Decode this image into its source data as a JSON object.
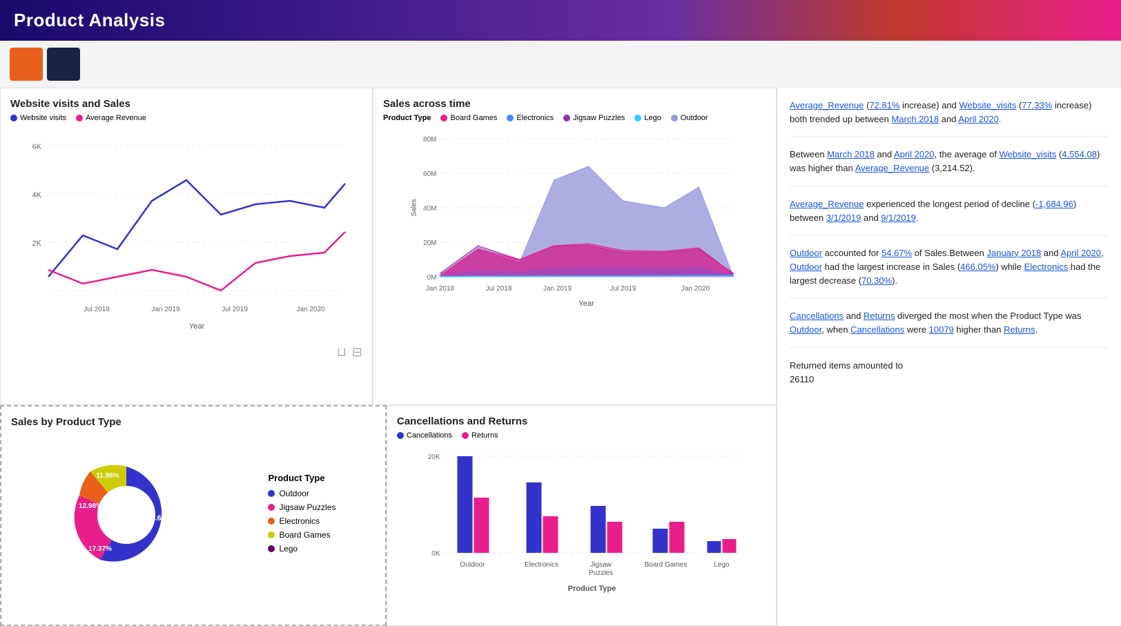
{
  "header": {
    "title": "Product Analysis"
  },
  "insights": [
    {
      "id": 1,
      "text_parts": [
        {
          "text": "Average_Revenue",
          "link": true
        },
        {
          "text": " ("
        },
        {
          "text": "72.81%",
          "link": true
        },
        {
          "text": " increase) and "
        },
        {
          "text": "Website_visits",
          "link": true
        },
        {
          "text": " ("
        },
        {
          "text": "77.33%",
          "link": true
        },
        {
          "text": " increase) both trended up between "
        },
        {
          "text": "March 2018",
          "link": true
        },
        {
          "text": " and "
        },
        {
          "text": "April 2020",
          "link": true
        },
        {
          "text": "."
        }
      ]
    },
    {
      "id": 2,
      "text_parts": [
        {
          "text": "Between "
        },
        {
          "text": "March 2018",
          "link": true
        },
        {
          "text": " and "
        },
        {
          "text": "April 2020",
          "link": true
        },
        {
          "text": ", the average of "
        },
        {
          "text": "Website_visits",
          "link": true
        },
        {
          "text": " ("
        },
        {
          "text": "4,554.08",
          "link": true
        },
        {
          "text": ") was higher than "
        },
        {
          "text": "Average_Revenue",
          "link": true
        },
        {
          "text": " (3,214.52)."
        }
      ]
    },
    {
      "id": 3,
      "text_parts": [
        {
          "text": "Average_Revenue",
          "link": true
        },
        {
          "text": " experienced the longest period of decline ("
        },
        {
          "text": "-1,684.96",
          "link": true
        },
        {
          "text": ") between "
        },
        {
          "text": "3/1/2019",
          "link": true
        },
        {
          "text": " and "
        },
        {
          "text": "9/1/2019",
          "link": true
        },
        {
          "text": "."
        }
      ]
    },
    {
      "id": 4,
      "text_parts": [
        {
          "text": "Outdoor",
          "link": true
        },
        {
          "text": " accounted for "
        },
        {
          "text": "54.67%",
          "link": true
        },
        {
          "text": " of Sales.Between "
        },
        {
          "text": "January 2018",
          "link": true
        },
        {
          "text": " and "
        },
        {
          "text": "April 2020",
          "link": true
        },
        {
          "text": ", "
        },
        {
          "text": "Outdoor",
          "link": true
        },
        {
          "text": " had the largest increase in Sales ("
        },
        {
          "text": "466.05%",
          "link": true
        },
        {
          "text": ") while "
        },
        {
          "text": "Electronics",
          "link": true
        },
        {
          "text": " had the largest decrease ("
        },
        {
          "text": "70.30%",
          "link": true
        },
        {
          "text": ")."
        }
      ]
    },
    {
      "id": 5,
      "text_parts": [
        {
          "text": "Cancellations",
          "link": true
        },
        {
          "text": " and "
        },
        {
          "text": "Returns",
          "link": true
        },
        {
          "text": " diverged the most when the Product Type was "
        },
        {
          "text": "Outdoor",
          "link": true
        },
        {
          "text": ", when "
        },
        {
          "text": "Cancellations",
          "link": true
        },
        {
          "text": " were "
        },
        {
          "text": "10079",
          "link": true
        },
        {
          "text": " higher than "
        },
        {
          "text": "Returns",
          "link": true
        },
        {
          "text": "."
        }
      ]
    },
    {
      "id": 6,
      "text_parts": [
        {
          "text": "Returned items amounted to 26110"
        }
      ]
    }
  ],
  "visits_chart": {
    "title": "Website visits and Sales",
    "legend": [
      {
        "label": "Website visits",
        "color": "#3333cc"
      },
      {
        "label": "Average Revenue",
        "color": "#e91e8c"
      }
    ],
    "y_labels": [
      "6K",
      "4K",
      "2K"
    ],
    "x_labels": [
      "Jul 2018",
      "Jan 2019",
      "Jul 2019",
      "Jan 2020"
    ],
    "x_axis_label": "Year"
  },
  "sales_time_chart": {
    "title": "Sales across time",
    "legend_title": "Product Type",
    "legend": [
      {
        "label": "Board Games",
        "color": "#e91e8c"
      },
      {
        "label": "Electronics",
        "color": "#4488ff"
      },
      {
        "label": "Jigsaw Puzzles",
        "color": "#8833aa"
      },
      {
        "label": "Lego",
        "color": "#33ccff"
      },
      {
        "label": "Outdoor",
        "color": "#9999dd"
      }
    ],
    "y_labels": [
      "80M",
      "60M",
      "40M",
      "20M",
      "0M"
    ],
    "x_labels": [
      "Jan 2018",
      "Jul 2018",
      "Jan 2019",
      "Jul 2019",
      "Jan 2020"
    ],
    "x_axis_label": "Year"
  },
  "product_type_chart": {
    "title": "Sales by Product Type",
    "segments": [
      {
        "label": "Outdoor",
        "color": "#3333cc",
        "percent": 54.67,
        "display": "54.67%"
      },
      {
        "label": "Jigsaw Puzzles",
        "color": "#e91e8c",
        "percent": 17.37,
        "display": "17.37%"
      },
      {
        "label": "Electronics",
        "color": "#e8601c",
        "percent": 12.98,
        "display": "12.98%"
      },
      {
        "label": "Board Games",
        "color": "#cccc00",
        "percent": 11.96,
        "display": "11.96%"
      },
      {
        "label": "Lego",
        "color": "#660066",
        "percent": 3.02,
        "display": ""
      }
    ],
    "legend": [
      {
        "label": "Outdoor",
        "color": "#3333cc"
      },
      {
        "label": "Jigsaw Puzzles",
        "color": "#e91e8c"
      },
      {
        "label": "Electronics",
        "color": "#e8601c"
      },
      {
        "label": "Board Games",
        "color": "#cccc00"
      },
      {
        "label": "Lego",
        "color": "#660066"
      }
    ]
  },
  "cancel_chart": {
    "title": "Cancellations and Returns",
    "legend": [
      {
        "label": "Cancellations",
        "color": "#3333cc"
      },
      {
        "label": "Returns",
        "color": "#e91e8c"
      }
    ],
    "y_labels": [
      "20K",
      "0K"
    ],
    "x_axis_label": "Product Type",
    "bars": [
      {
        "category": "Outdoor",
        "cancellations": 100,
        "returns": 55
      },
      {
        "category": "Electronics",
        "cancellations": 72,
        "returns": 38
      },
      {
        "category": "Jigsaw\nPuzzles",
        "cancellations": 48,
        "returns": 32
      },
      {
        "category": "Board Games",
        "cancellations": 25,
        "returns": 32
      },
      {
        "category": "Lego",
        "cancellations": 12,
        "returns": 15
      }
    ]
  }
}
